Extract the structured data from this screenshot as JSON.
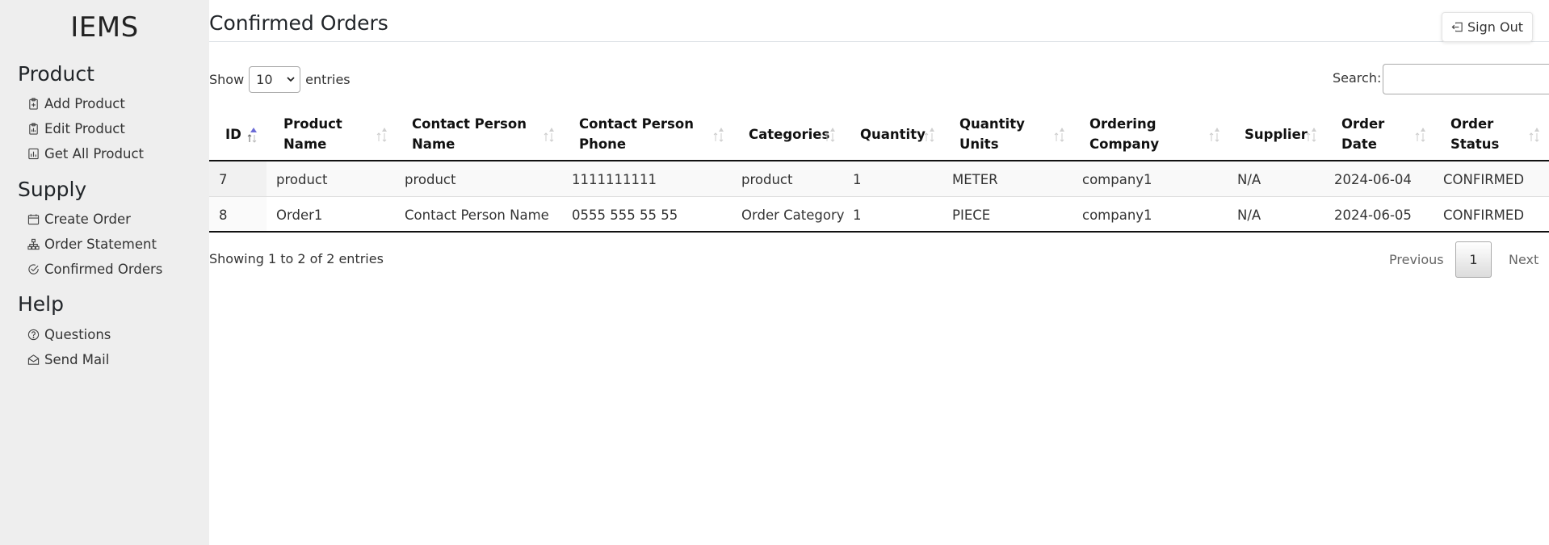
{
  "brand": "IEMS",
  "sidebar": {
    "sections": [
      {
        "title": "Product",
        "items": [
          {
            "label": "Add Product",
            "icon": "clipboard-plus-icon"
          },
          {
            "label": "Edit Product",
            "icon": "clipboard-data-icon"
          },
          {
            "label": "Get All Product",
            "icon": "bar-chart-icon"
          }
        ]
      },
      {
        "title": "Supply",
        "items": [
          {
            "label": "Create Order",
            "icon": "calendar-icon"
          },
          {
            "label": "Order Statement",
            "icon": "diagram-icon"
          },
          {
            "label": "Confirmed Orders",
            "icon": "check-circle-icon"
          }
        ]
      },
      {
        "title": "Help",
        "items": [
          {
            "label": "Questions",
            "icon": "question-circle-icon"
          },
          {
            "label": "Send Mail",
            "icon": "envelope-open-icon"
          }
        ]
      }
    ]
  },
  "header": {
    "title": "Confirmed Orders",
    "signout_label": "Sign Out",
    "signout_icon": "box-arrow-left-icon"
  },
  "controls": {
    "show_label": "Show",
    "entries_value": "10",
    "entries_label": "entries",
    "search_label": "Search:",
    "search_value": ""
  },
  "table": {
    "columns": [
      {
        "line1": "ID",
        "line2": "",
        "sort": "ascending"
      },
      {
        "line1": "Product",
        "line2": "Name",
        "sort": "none"
      },
      {
        "line1": "Contact Person",
        "line2": "Name",
        "sort": "none"
      },
      {
        "line1": "Contact Person",
        "line2": "Phone",
        "sort": "none"
      },
      {
        "line1": "Categories",
        "line2": "",
        "sort": "none"
      },
      {
        "line1": "Quantity",
        "line2": "",
        "sort": "none"
      },
      {
        "line1": "Quantity",
        "line2": "Units",
        "sort": "none"
      },
      {
        "line1": "Ordering",
        "line2": "Company",
        "sort": "none"
      },
      {
        "line1": "Supplier",
        "line2": "",
        "sort": "none"
      },
      {
        "line1": "Order",
        "line2": "Date",
        "sort": "none"
      },
      {
        "line1": "Order",
        "line2": "Status",
        "sort": "none"
      }
    ],
    "rows": [
      [
        "7",
        "product",
        "product",
        "1111111111",
        "product",
        "1",
        "METER",
        "company1",
        "N/A",
        "2024-06-04",
        "CONFIRMED"
      ],
      [
        "8",
        "Order1",
        "Contact Person Name",
        "0555 555 55 55",
        "Order Category",
        "1",
        "PIECE",
        "company1",
        "N/A",
        "2024-06-05",
        "CONFIRMED"
      ]
    ]
  },
  "footer": {
    "info": "Showing 1 to 2 of 2 entries",
    "previous": "Previous",
    "page": "1",
    "next": "Next"
  },
  "colors": {
    "sidebar_bg": "#eeeeee",
    "sort_active": "#6b6bd6",
    "sort_inactive": "#cfcfcf"
  }
}
